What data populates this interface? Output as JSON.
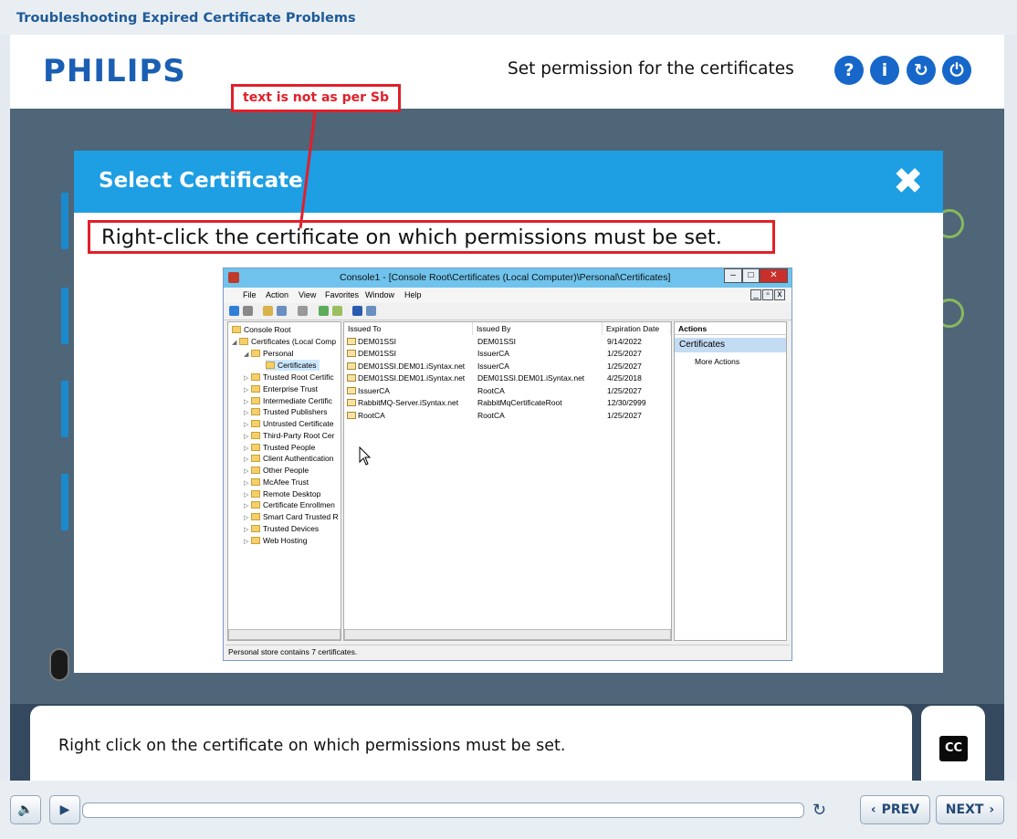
{
  "course": {
    "title": "Troubleshooting  Expired Certificate Problems"
  },
  "header": {
    "logo": "PHILIPS",
    "slide_title": "Set permission for the certificates",
    "buttons": [
      {
        "label": "?"
      },
      {
        "label": "i"
      },
      {
        "label": "↻"
      },
      {
        "label": "⏻"
      }
    ]
  },
  "dialog": {
    "title": "Select Certificate",
    "close": "✖",
    "instruction": "Right-click the certificate on which permissions must be set."
  },
  "annotation": {
    "text": "text is not as per Sb"
  },
  "mmc": {
    "title": "Console1 - [Console Root\\Certificates (Local Computer)\\Personal\\Certificates]",
    "menu": [
      "File",
      "Action",
      "View",
      "Favorites",
      "Window",
      "Help"
    ],
    "tree": [
      "Console Root",
      "Certificates (Local Comp",
      "Personal",
      "Certificates",
      "Trusted Root Certific",
      "Enterprise Trust",
      "Intermediate Certific",
      "Trusted Publishers",
      "Untrusted Certificate",
      "Third-Party Root Cer",
      "Trusted People",
      "Client Authentication",
      "Other People",
      "McAfee Trust",
      "Remote Desktop",
      "Certificate Enrollmen",
      "Smart Card Trusted R",
      "Trusted Devices",
      "Web Hosting"
    ],
    "columns": [
      "Issued To",
      "Issued By",
      "Expiration Date"
    ],
    "rows": [
      [
        "DEM01SSI",
        "DEM01SSI",
        "9/14/2022"
      ],
      [
        "DEM01SSI",
        "IssuerCA",
        "1/25/2027"
      ],
      [
        "DEM01SSI.DEM01.iSyntax.net",
        "IssuerCA",
        "1/25/2027"
      ],
      [
        "DEM01SSI.DEM01.iSyntax.net",
        "DEM01SSI.DEM01.iSyntax.net",
        "4/25/2018"
      ],
      [
        "IssuerCA",
        "RootCA",
        "1/25/2027"
      ],
      [
        "RabbitMQ-Server.iSyntax.net",
        "RabbitMqCertificateRoot",
        "12/30/2999"
      ],
      [
        "RootCA",
        "RootCA",
        "1/25/2027"
      ]
    ],
    "actions_header": "Actions",
    "actions_section": "Certificates",
    "actions_item": "More Actions",
    "status": "Personal store contains 7 certificates."
  },
  "caption": {
    "text": "Right click on the certificate on which permissions must be set.",
    "cc": "CC"
  },
  "player": {
    "prev": "PREV",
    "next": "NEXT"
  }
}
